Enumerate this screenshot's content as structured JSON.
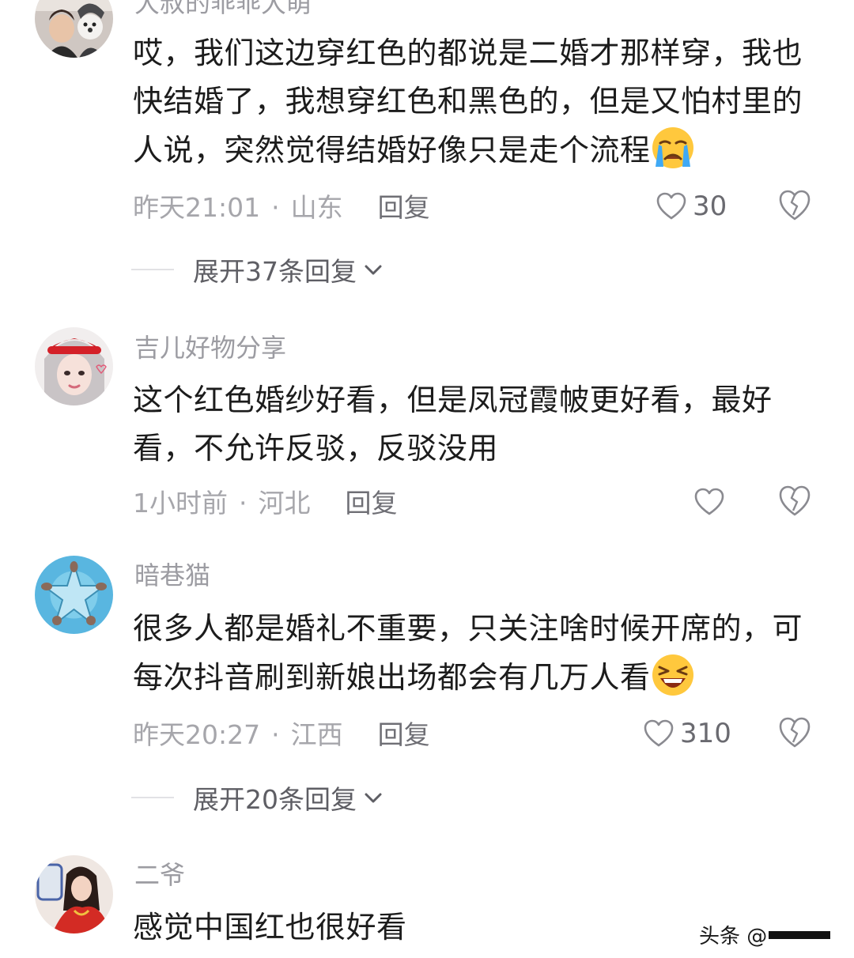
{
  "comments": [
    {
      "username": "大叔的乖乖大萌",
      "text": "哎，我们这边穿红色的都说是二婚才那样穿，我也快结婚了，我想穿红色和黑色的，但是又怕村里的人说，突然觉得结婚好像只是走个流程",
      "emoji": "crying-face-emoji",
      "time": "昨天21:01",
      "dot": "·",
      "location": "山东",
      "reply_label": "回复",
      "likes": "30",
      "expand_label": "展开37条回复"
    },
    {
      "username": "吉儿好物分享",
      "text": "这个红色婚纱好看，但是凤冠霞帔更好看，最好看，不允许反驳，反驳没用",
      "time": "1小时前",
      "dot": "·",
      "location": "河北",
      "reply_label": "回复",
      "likes": ""
    },
    {
      "username": "暗巷猫",
      "text": "很多人都是婚礼不重要，只关注啥时候开席的，可每次抖音刷到新娘出场都会有几万人看",
      "emoji": "laughing-face-emoji",
      "time": "昨天20:27",
      "dot": "·",
      "location": "江西",
      "reply_label": "回复",
      "likes": "310",
      "expand_label": "展开20条回复"
    },
    {
      "username": "二爷",
      "text": "感觉中国红也很好看"
    }
  ],
  "watermark": {
    "text": "头条 @"
  },
  "icons": {
    "like": "heart-outline-icon",
    "dislike": "broken-heart-icon",
    "expand": "chevron-down-icon"
  },
  "colors": {
    "text_primary": "#1c1c1c",
    "text_secondary": "#a6a6ab",
    "username": "#9c9ca2",
    "reply": "#6f6f75"
  }
}
